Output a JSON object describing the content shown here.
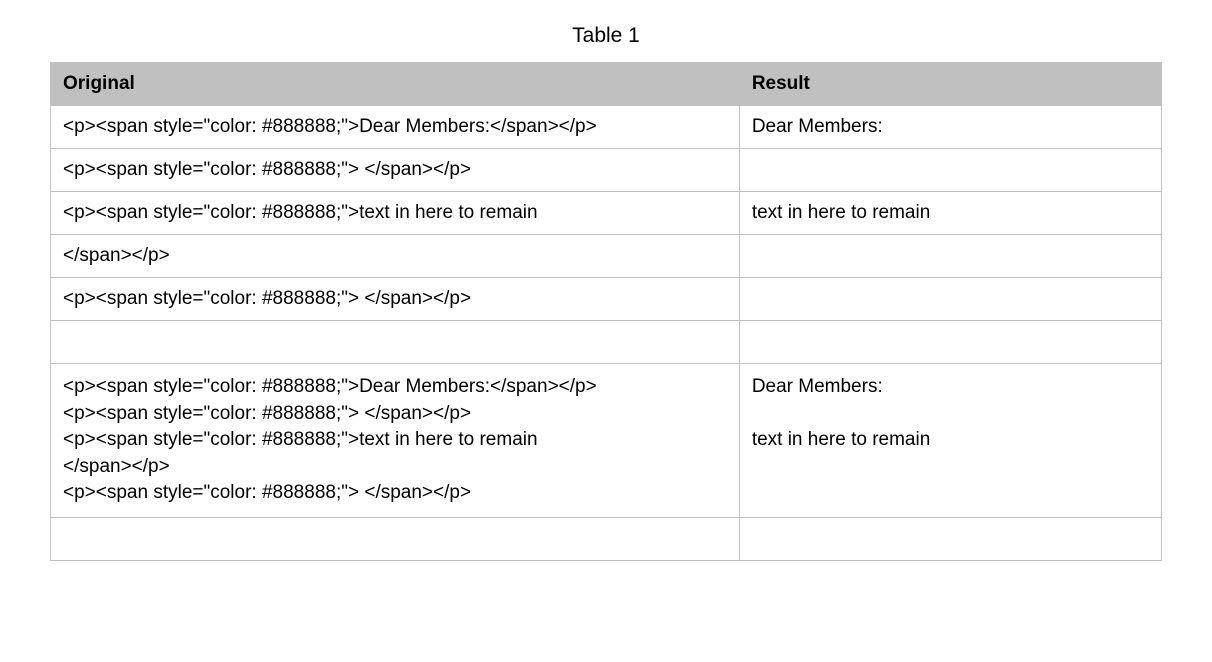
{
  "title": "Table 1",
  "headers": {
    "original": "Original",
    "result": "Result"
  },
  "rows": [
    {
      "original": "<p><span style=\"color: #888888;\">Dear Members:</span></p>",
      "result": "Dear Members:"
    },
    {
      "original": "<p><span style=\"color: #888888;\"> </span></p>",
      "result": ""
    },
    {
      "original": "<p><span style=\"color: #888888;\">text in here to remain",
      "result": "text in here to remain"
    },
    {
      "original": "</span></p>",
      "result": ""
    },
    {
      "original": "<p><span style=\"color: #888888;\"> </span></p>",
      "result": ""
    },
    {
      "original": "",
      "result": ""
    },
    {
      "original": "<p><span style=\"color: #888888;\">Dear Members:</span></p>\n<p><span style=\"color: #888888;\"> </span></p>\n<p><span style=\"color: #888888;\">text in here to remain\n</span></p>\n<p><span style=\"color: #888888;\"> </span></p>",
      "result": "Dear Members:\n\ntext in here to remain"
    },
    {
      "original": "",
      "result": ""
    }
  ]
}
